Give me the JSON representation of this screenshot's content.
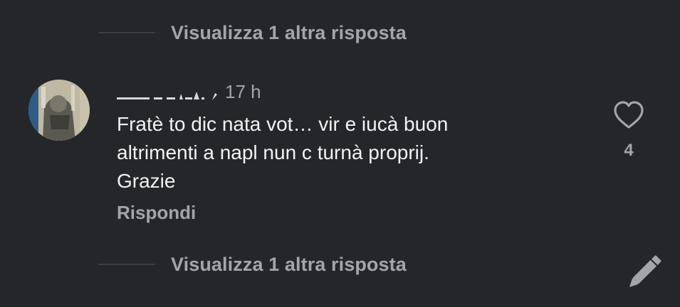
{
  "colors": {
    "background": "#25262a",
    "primary_text": "#f2f2f2",
    "secondary_text": "#a4a5ab",
    "divider": "#3c3d42"
  },
  "replies_top": {
    "label": "Visualizza 1 altra risposta"
  },
  "comment": {
    "timestamp": "17 h",
    "text": "Fratè to dic nata vot… vir e iucà buon\naltrimenti a napl nun c turnà proprij.\nGrazie",
    "reply_label": "Rispondi",
    "like_icon": "heart-outline-icon",
    "like_count": "4"
  },
  "replies_bottom": {
    "label": "Visualizza 1 altra risposta"
  },
  "fab": {
    "icon": "pencil-icon"
  }
}
